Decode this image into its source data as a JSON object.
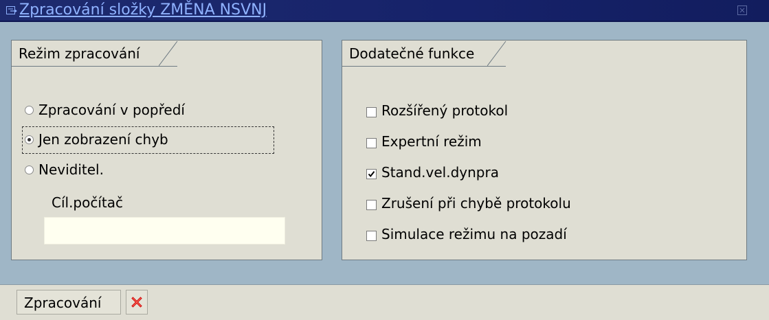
{
  "window": {
    "title": "Zpracování složky ZMĚNA NSVNJ"
  },
  "processing_mode": {
    "heading": "Režim zpracování",
    "options": [
      {
        "label": "Zpracování v popředí",
        "selected": false
      },
      {
        "label": "Jen zobrazení chyb",
        "selected": true
      },
      {
        "label": "Neviditel.",
        "selected": false
      }
    ],
    "target_label": "Cíl.počítač",
    "target_value": ""
  },
  "extra_functions": {
    "heading": "Dodatečné funkce",
    "items": [
      {
        "label": "Rozšířený protokol",
        "checked": false
      },
      {
        "label": "Expertní režim",
        "checked": false
      },
      {
        "label": "Stand.vel.dynpra",
        "checked": true
      },
      {
        "label": "Zrušení při chybě protokolu",
        "checked": false
      },
      {
        "label": "Simulace režimu na pozadí",
        "checked": false
      }
    ]
  },
  "footer": {
    "process_button": "Zpracování",
    "cancel_icon": "cancel-x-icon"
  },
  "colors": {
    "titlebar": "#1a2568",
    "title_text": "#8fb2ff",
    "background": "#9fb6c6",
    "panel": "#dfded3",
    "cancel_red": "#d01010"
  }
}
